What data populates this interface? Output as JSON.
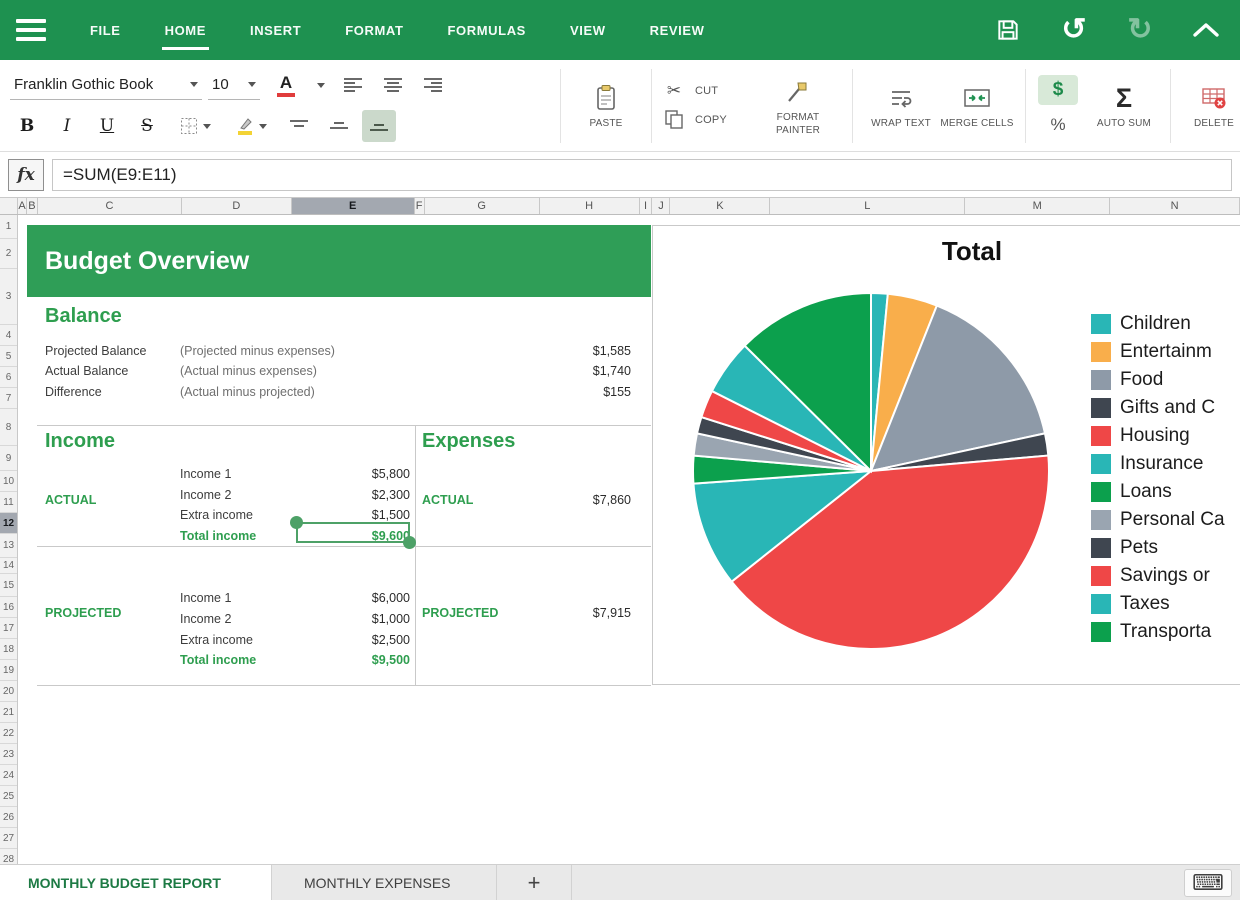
{
  "menubar": {
    "items": [
      "FILE",
      "HOME",
      "INSERT",
      "FORMAT",
      "FORMULAS",
      "VIEW",
      "REVIEW"
    ],
    "active_index": 1
  },
  "icons": {
    "cut": "✂",
    "auto_sum": "Σ",
    "keyboard": "⌨",
    "undo": "↺",
    "redo": "↻"
  },
  "toolbar": {
    "font_name": "Franklin Gothic Book",
    "font_size": "10",
    "font_color_label": "A",
    "bold": "B",
    "italic": "I",
    "underline": "U",
    "strike": "S",
    "paste": "PASTE",
    "cut": "CUT",
    "copy": "COPY",
    "format_painter": "FORMAT PAINTER",
    "wrap_text": "WRAP TEXT",
    "merge_cells": "MERGE CELLS",
    "currency": "$",
    "percent": "%",
    "auto_sum": "AUTO SUM",
    "delete": "DELETE"
  },
  "formula_bar": {
    "fx": "fx",
    "formula": "=SUM(E9:E11)"
  },
  "grid": {
    "columns": [
      "A",
      "B",
      "C",
      "D",
      "E",
      "F",
      "G",
      "H",
      "I",
      "J",
      "K",
      "L",
      "M",
      "N"
    ],
    "selected_column": "E",
    "row_numbers": [
      1,
      2,
      3,
      4,
      5,
      6,
      7,
      8,
      9,
      10,
      11,
      12,
      13,
      14,
      15,
      16,
      17,
      18,
      19,
      20,
      21,
      22,
      23,
      24,
      25,
      26,
      27,
      28
    ],
    "selected_row": 12
  },
  "sheet": {
    "title": "Budget Overview",
    "balance": {
      "heading": "Balance",
      "rows": [
        {
          "label": "Projected Balance",
          "formula": "(Projected  minus expenses)",
          "value": "$1,585"
        },
        {
          "label": "Actual Balance",
          "formula": "(Actual  minus expenses)",
          "value": "$1,740"
        },
        {
          "label": "Difference",
          "formula": "(Actual minus projected)",
          "value": "$155"
        }
      ]
    },
    "income": {
      "heading": "Income",
      "actual_label": "ACTUAL",
      "actual_rows": [
        {
          "label": "Income 1",
          "value": "$5,800"
        },
        {
          "label": "Income 2",
          "value": "$2,300"
        },
        {
          "label": "Extra income",
          "value": "$1,500"
        },
        {
          "label": "Total income",
          "value": "$9,600",
          "bold": true
        }
      ],
      "projected_label": "PROJECTED",
      "projected_rows": [
        {
          "label": "Income 1",
          "value": "$6,000"
        },
        {
          "label": "Income 2",
          "value": "$1,000"
        },
        {
          "label": "Extra income",
          "value": "$2,500"
        },
        {
          "label": "Total income",
          "value": "$9,500",
          "bold": true
        }
      ]
    },
    "expenses": {
      "heading": "Expenses",
      "actual_label": "ACTUAL",
      "actual_value": "$7,860",
      "projected_label": "PROJECTED",
      "projected_value": "$7,915"
    }
  },
  "chart_data": {
    "type": "pie",
    "title": "Total",
    "legend_position": "right",
    "categories": [
      "Children",
      "Entertainm",
      "Food",
      "Gifts and C",
      "Housing",
      "Insurance",
      "Loans",
      "Personal Ca",
      "Pets",
      "Savings or",
      "Taxes",
      "Transporta"
    ],
    "values": [
      1.5,
      4.5,
      15.5,
      2,
      40.5,
      9.5,
      2.5,
      2,
      1.5,
      2.5,
      5,
      12.5
    ],
    "colors": [
      "#29b6b6",
      "#f9ae4b",
      "#8e9aa8",
      "#3f4650",
      "#ef4747",
      "#29b6b6",
      "#0ca04d",
      "#9aa5b1",
      "#3f4650",
      "#ef4747",
      "#29b6b6",
      "#0ca04d"
    ]
  },
  "tabbar": {
    "tabs": [
      {
        "label": "MONTHLY BUDGET REPORT",
        "active": true
      },
      {
        "label": "MONTHLY EXPENSES",
        "active": false
      }
    ],
    "add_label": "+"
  },
  "colors": {
    "app_green": "#1e9150",
    "banner_green": "#2f9e57",
    "heading_green": "#2e9e4f",
    "selection_green": "#4da167",
    "active_tab_green": "#1d7a44"
  }
}
